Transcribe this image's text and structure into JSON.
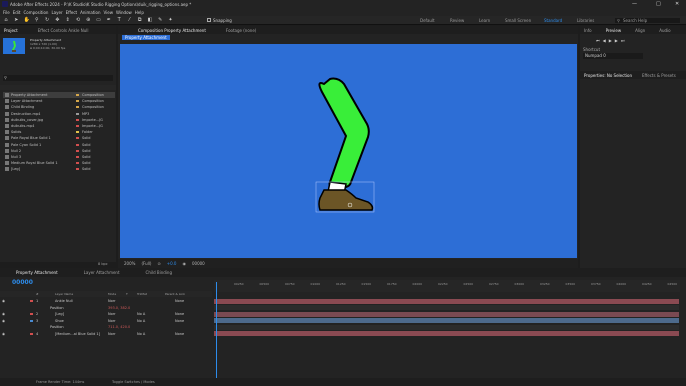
{
  "window": {
    "title": "Adobe After Effects 2024 - P:\\K Studio\\K Studio Rigging Options\\duik_rigging_options.aep *",
    "minimize": "—",
    "maximize": "□",
    "close": "✕"
  },
  "menu": [
    "File",
    "Edit",
    "Composition",
    "Layer",
    "Effect",
    "Animation",
    "View",
    "Window",
    "Help"
  ],
  "toolbar": {
    "snapping": "Snapping",
    "workspaces": [
      "Default",
      "Review",
      "Learn",
      "Small Screen",
      "Standard",
      "Libraries"
    ],
    "active_workspace": "Standard",
    "search_placeholder": "Search Help"
  },
  "project": {
    "tabs": [
      "Project",
      "Effect Controls Ankle Null"
    ],
    "selected_name": "Property Attachment",
    "info_line1": "1280 x 720 (1.00)",
    "info_line2": "Δ 0;00;10;00, 30.00 fps",
    "items": [
      {
        "name": "Property Attachment",
        "type": "Composition",
        "color": "#d4a64a",
        "selected": true
      },
      {
        "name": "Layer Attachment",
        "type": "Composition",
        "color": "#d4a64a",
        "selected": false
      },
      {
        "name": "Child Binding",
        "type": "Composition",
        "color": "#d4a64a",
        "selected": false
      },
      {
        "name": "Destruction.mp4",
        "type": "MP3",
        "color": "#9a9a9a",
        "selected": false
      },
      {
        "name": "duikuiks_cover.jpg",
        "type": "Importe...JG",
        "color": "#d24f4f",
        "selected": false
      },
      {
        "name": "duikuiks.mp4",
        "type": "Importe...JG",
        "color": "#d24f4f",
        "selected": false
      },
      {
        "name": "Solids",
        "type": "Folder",
        "color": "#e2c24a",
        "selected": false
      },
      {
        "name": "Pale Royal Blue Solid 1",
        "type": "Solid",
        "color": "#d24f4f",
        "selected": false
      },
      {
        "name": "Pale Cyan Solid 1",
        "type": "Solid",
        "color": "#d24f4f",
        "selected": false
      },
      {
        "name": "Null 2",
        "type": "Solid",
        "color": "#d24f4f",
        "selected": false
      },
      {
        "name": "Null 3",
        "type": "Solid",
        "color": "#d24f4f",
        "selected": false
      },
      {
        "name": "Medium Royal Blue Solid 1",
        "type": "Solid",
        "color": "#d24f4f",
        "selected": false
      },
      {
        "name": "[Leg]",
        "type": "Solid",
        "color": "#d24f4f",
        "selected": false
      }
    ],
    "bpc": "8 bpc"
  },
  "viewer": {
    "tabs": [
      "Composition Property Attachment",
      "Footage (none)"
    ],
    "breadcrumb": "Property Attachment",
    "zoom": "200%",
    "resolution": "(Full)",
    "exposure": "+0.0",
    "timecode": "00000"
  },
  "right": {
    "tabs": [
      "Info",
      "Preview",
      "Align",
      "Audio"
    ],
    "shortcut_label": "Shortcut",
    "shortcut_value": "Numpad 0",
    "props_tabs": [
      "Properties: No Selection",
      "Effects & Presets"
    ]
  },
  "timeline": {
    "tabs": [
      "Property Attachment",
      "Layer Attachment",
      "Child Binding"
    ],
    "timecode": "00000",
    "columns": [
      "#",
      "Layer Name",
      "Mode",
      "T",
      "TrkMat",
      "Parent & Link"
    ],
    "layers": [
      {
        "num": "1",
        "name": "Ankle Null",
        "mode": "Norr",
        "track": "",
        "parent": "None",
        "label": "#d24f4f"
      },
      {
        "num": "",
        "name": "Position",
        "mode": "",
        "track": "",
        "parent": "",
        "value": "393.0, 382.0",
        "label": ""
      },
      {
        "num": "2",
        "name": "[Leg]",
        "mode": "Norr",
        "track": "No A",
        "parent": "None",
        "label": "#d24f4f"
      },
      {
        "num": "3",
        "name": "Shoe",
        "mode": "Norr",
        "track": "No A",
        "parent": "None",
        "label": "#4a8bd2"
      },
      {
        "num": "",
        "name": "Position",
        "mode": "",
        "track": "",
        "parent": "",
        "value": "711.0, 420.0",
        "label": ""
      },
      {
        "num": "4",
        "name": "[Medium...al Blue Solid 1]",
        "mode": "Norr",
        "track": "No A",
        "parent": "None",
        "label": "#d24f4f"
      }
    ],
    "ruler_ticks": [
      "00250",
      "00500",
      "00750",
      "01000",
      "01250",
      "01500",
      "01750",
      "02000",
      "02250",
      "02500",
      "02750",
      "03000",
      "03250",
      "03500",
      "03750",
      "04000",
      "04250",
      "04500"
    ],
    "bar_colors": [
      "#8a4a52",
      "#2c2c2c",
      "#7a4a52",
      "#4d6a8c",
      "#2c2c2c",
      "#8a4a52"
    ]
  },
  "status": {
    "render_time": "Frame Render Time: 144ms",
    "toggle": "Toggle Switches / Modes"
  }
}
